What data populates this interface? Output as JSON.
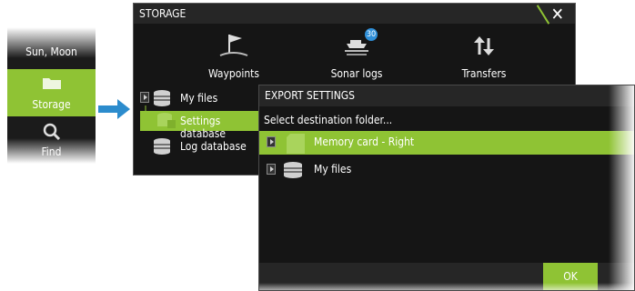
{
  "side_menu": {
    "items": [
      {
        "label": "Sun, Moon",
        "icon": "sun-moon-icon"
      },
      {
        "label": "Storage",
        "icon": "folder-icon",
        "selected": true
      },
      {
        "label": "Find",
        "icon": "magnifier-icon"
      }
    ]
  },
  "storage_dialog": {
    "title": "STORAGE",
    "close_icon": "close-icon",
    "categories": [
      {
        "label": "Waypoints",
        "icon": "waypoint-flag-icon"
      },
      {
        "label": "Sonar logs",
        "icon": "sonar-boat-icon",
        "badge": "30"
      },
      {
        "label": "Transfers",
        "icon": "transfer-arrows-icon"
      }
    ],
    "tree": [
      {
        "label": "My files",
        "icon": "database-icon"
      },
      {
        "label": "Settings database",
        "icon": "database-lock-icon",
        "selected": true
      },
      {
        "label": "Log database",
        "icon": "database-icon"
      }
    ]
  },
  "export_dialog": {
    "title": "EXPORT SETTINGS",
    "prompt": "Select destination folder...",
    "folders": [
      {
        "label": "Memory card - Right",
        "icon": "memory-card-icon",
        "selected": true
      },
      {
        "label": "My files",
        "icon": "database-icon"
      }
    ],
    "ok_label": "OK"
  },
  "colors": {
    "accent": "#8fc334",
    "badge": "#2f8fd8",
    "dialog_bg": "#151515",
    "header_bg": "#262626",
    "arrow": "#2c8ccd"
  }
}
